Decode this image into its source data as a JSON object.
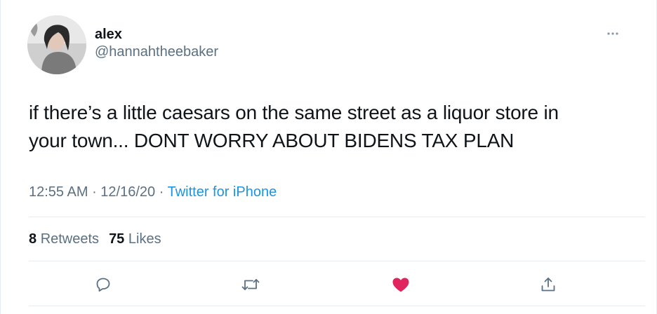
{
  "tweet": {
    "display_name": "alex",
    "handle": "@hannahtheebaker",
    "text_line1": "if there’s a little caesars on the same street as a liquor store in",
    "text_line2": "your town... DONT WORRY ABOUT BIDENS TAX PLAN",
    "time": "12:55 AM",
    "date": "12/16/20",
    "separator": "·",
    "source": "Twitter for iPhone"
  },
  "stats": {
    "retweets_count": "8",
    "retweets_label": "Retweets",
    "likes_count": "75",
    "likes_label": "Likes"
  },
  "icons": {
    "more": "more-horizontal-icon",
    "reply": "reply-icon",
    "retweet": "retweet-icon",
    "like": "heart-icon",
    "share": "share-icon"
  },
  "colors": {
    "link": "#1b95e0",
    "like_active": "#e0245e",
    "secondary_text": "#5b7083",
    "divider": "#e6ecf0"
  }
}
